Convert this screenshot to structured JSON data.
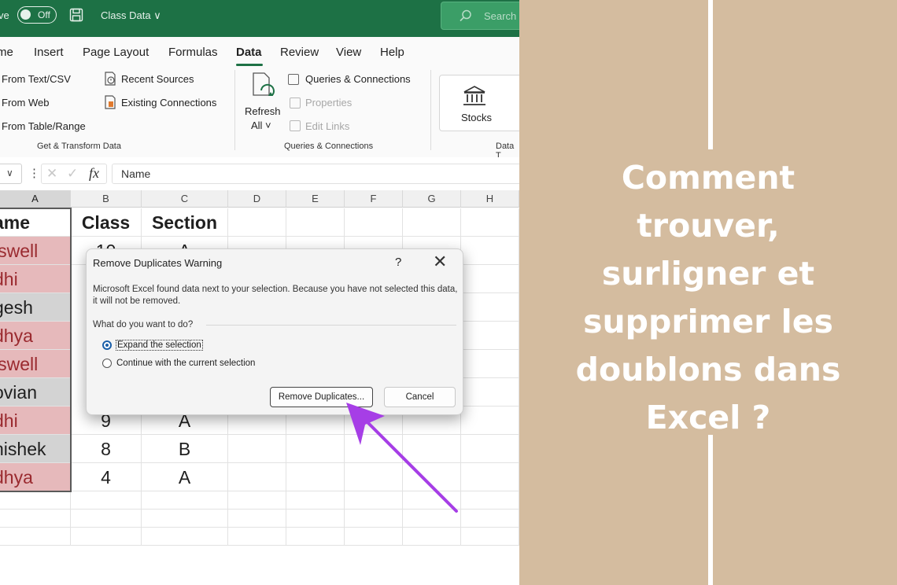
{
  "titlebar": {
    "autosave_label": "ve",
    "toggle_state": "Off",
    "doc_title": "Class Data ∨",
    "search_placeholder": "Search"
  },
  "menu": [
    "me",
    "Insert",
    "Page Layout",
    "Formulas",
    "Data",
    "Review",
    "View",
    "Help"
  ],
  "ribbon": {
    "get_transform": {
      "from_text_csv": "From Text/CSV",
      "from_web": "From Web",
      "from_table": "From Table/Range",
      "recent_sources": "Recent Sources",
      "existing_connections": "Existing Connections",
      "label": "Get & Transform Data"
    },
    "queries": {
      "refresh_line1": "Refresh",
      "refresh_line2": "All ˅",
      "queries_connections": "Queries & Connections",
      "properties": "Properties",
      "edit_links": "Edit Links",
      "label": "Queries & Connections"
    },
    "data_types": {
      "stocks": "Stocks",
      "label": "Data T"
    }
  },
  "formula_bar": {
    "fx": "fx",
    "value": "Name"
  },
  "columns": [
    "A",
    "B",
    "C",
    "D",
    "E",
    "F",
    "G",
    "H"
  ],
  "sheet": {
    "header": {
      "name": "ame",
      "class": "Class",
      "section": "Section"
    },
    "partial_top": {
      "class": "10",
      "section": "A"
    },
    "names": [
      "iswell",
      "dhi",
      "gesh",
      "dhya",
      "iswell",
      "ovian",
      "dhi",
      "nishek",
      "dhya"
    ],
    "name_styles": [
      "dup",
      "dup",
      "gray",
      "dup",
      "dup",
      "gray",
      "dup",
      "gray",
      "dup"
    ],
    "bottom_rows": [
      {
        "class": "9",
        "section": "A"
      },
      {
        "class": "8",
        "section": "B"
      },
      {
        "class": "4",
        "section": "A"
      }
    ]
  },
  "dialog": {
    "title": "Remove Duplicates Warning",
    "help": "?",
    "close": "✕",
    "message": "Microsoft Excel found data next to your selection. Because you have not selected this data, it will not be removed.",
    "question": "What do you want to do?",
    "option_expand": "Expand the selection",
    "option_continue": "Continue with the current selection",
    "selected_option": "expand",
    "remove_button": "Remove Duplicates...",
    "cancel_button": "Cancel"
  },
  "headline": {
    "line1": "Comment",
    "line2": "trouver,",
    "line3": "surligner et",
    "line4": "supprimer les",
    "line5": "doublons dans",
    "line6": "Excel ?"
  },
  "colors": {
    "excel_green": "#1d7145",
    "duplicate_fill": "#e6b9bb",
    "duplicate_text": "#9a2a2f",
    "arrow": "#a63ee6",
    "panel_bg": "#d4bc9f"
  }
}
